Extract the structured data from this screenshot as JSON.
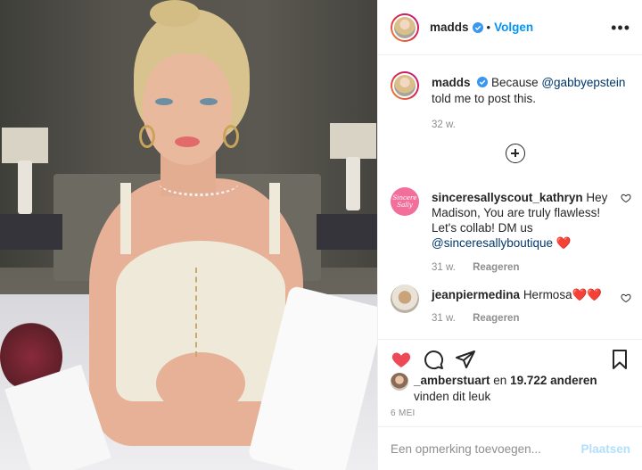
{
  "post": {
    "author": "madds",
    "follow_label": "Volgen",
    "dot": "•",
    "more": "•••"
  },
  "caption": {
    "username": "madds",
    "text_before": "Because ",
    "mention": "@gabbyepstein",
    "text_after": " told me to post this.",
    "time": "32 w."
  },
  "comments": [
    {
      "username": "sinceresallyscout_kathryn",
      "text": "Hey Madison, You are truly flawless! Let's collab! DM us",
      "mention": "@sinceresallyboutique",
      "emoji": "❤️",
      "time": "31 w.",
      "reply_label": "Reageren",
      "avatar_text": [
        "Sincere",
        "Sally"
      ]
    },
    {
      "username": "jeanpiermedina",
      "text": "Hermosa",
      "emoji": "❤️❤️",
      "time": "31 w.",
      "reply_label": "Reageren"
    }
  ],
  "likes": {
    "user": "_amberstuart",
    "connector": " en ",
    "count": "19.722 anderen",
    "suffix": "vinden dit leuk"
  },
  "date": "6 MEI",
  "add_comment": {
    "placeholder": "Een opmerking toevoegen...",
    "post_label": "Plaatsen"
  },
  "colors": {
    "accent_blue": "#0095f6",
    "mention_blue": "#00376b",
    "like_red": "#ed4956",
    "muted": "#8e8e8e",
    "post_disabled": "#b2dffc"
  },
  "icons": [
    "verified-badge-icon",
    "more-options-icon",
    "load-more-comments-icon",
    "heart-icon",
    "comment-icon",
    "share-icon",
    "bookmark-icon"
  ]
}
